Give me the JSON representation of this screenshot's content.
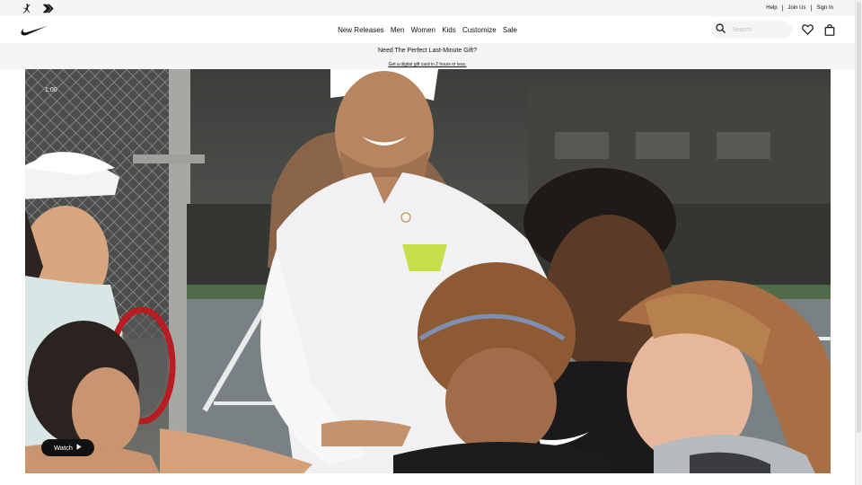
{
  "utility_bar": {
    "brand_icons": [
      "jordan-jumpman-icon",
      "converse-chevron-icon"
    ],
    "links": [
      "Help",
      "Join Us",
      "Sign In"
    ],
    "separator": "|"
  },
  "nav": {
    "logo_icon": "nike-swoosh-icon",
    "menu": [
      "New Releases",
      "Men",
      "Women",
      "Kids",
      "Customize",
      "Sale"
    ],
    "search": {
      "placeholder": "Search",
      "value": "",
      "icon": "search-icon"
    },
    "favorites_icon": "heart-icon",
    "bag_icon": "shopping-bag-icon"
  },
  "promo": {
    "title": "Need The Perfect Last-Minute Gift?",
    "link": "Get a digital gift card in 2 hours or less."
  },
  "hero": {
    "media": "video",
    "time": "1:00",
    "watch_label": "Watch",
    "play_icon": "play-icon"
  },
  "colors": {
    "background": "#ffffff",
    "utility_bg": "#f5f5f5",
    "text": "#111111",
    "button_bg": "#111111"
  }
}
